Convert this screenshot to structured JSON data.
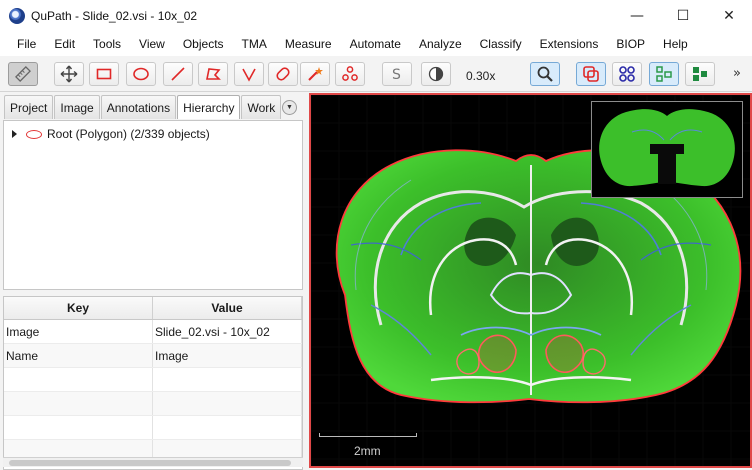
{
  "window": {
    "title": "QuPath - Slide_02.vsi - 10x_02",
    "minimize": "—",
    "maximize": "☐",
    "close": "✕"
  },
  "menu": [
    "File",
    "Edit",
    "Tools",
    "View",
    "Objects",
    "TMA",
    "Measure",
    "Automate",
    "Analyze",
    "Classify",
    "Extensions",
    "BIOP",
    "Help"
  ],
  "toolbar": {
    "zoom": "0.30x",
    "overflow": "»",
    "buttons": [
      "show-analysis-pane",
      "move-tool",
      "rectangle-tool",
      "ellipse-tool",
      "line-tool",
      "polygon-tool",
      "polyline-tool",
      "brush-tool",
      "wand-tool",
      "points-tool",
      "selection-mode",
      "brightness-contrast",
      "zoom-to-fit",
      "show-annotations",
      "show-tma-grid",
      "show-detections",
      "fill-detections"
    ]
  },
  "left": {
    "tabs": [
      "Project",
      "Image",
      "Annotations",
      "Hierarchy",
      "Work"
    ],
    "selected_tab": "Hierarchy",
    "tree_root": "Root (Polygon) (2/339 objects)",
    "table": {
      "headers": [
        "Key",
        "Value"
      ],
      "rows": [
        [
          "Image",
          "Slide_02.vsi - 10x_02"
        ],
        [
          "Name",
          "Image"
        ],
        [
          "",
          ""
        ],
        [
          "",
          ""
        ],
        [
          "",
          ""
        ],
        [
          "",
          ""
        ]
      ]
    }
  },
  "viewer": {
    "scale_label": "2mm",
    "border_color": "#e04848",
    "tissue_color": "#3fbf2e",
    "annotation_color": "#ff3b3b"
  }
}
